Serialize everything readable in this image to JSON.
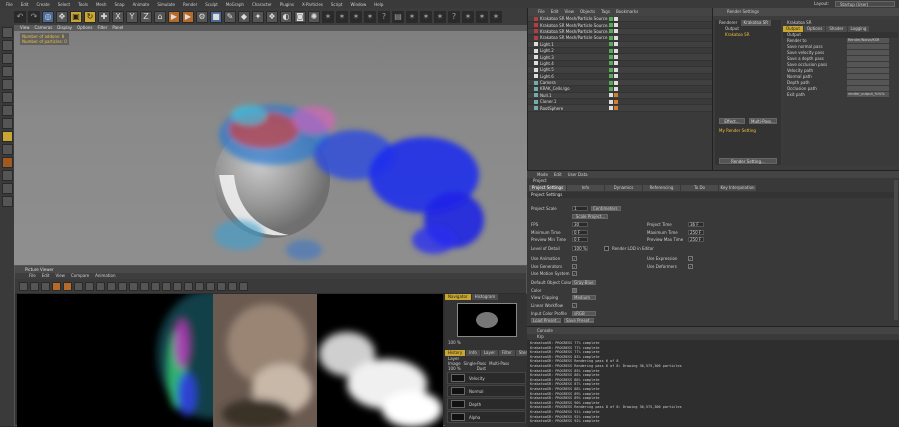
{
  "menubar": {
    "items": [
      "File",
      "Edit",
      "Create",
      "Select",
      "Tools",
      "Mesh",
      "Snap",
      "Animate",
      "Simulate",
      "Render",
      "Sculpt",
      "MoGraph",
      "Character",
      "Plugins",
      "X-Particles",
      "Script",
      "Window",
      "Help"
    ],
    "layout_label": "Layout:",
    "layout_value": "Startup (User)"
  },
  "viewport": {
    "menu": [
      "View",
      "Cameras",
      "Display",
      "Options",
      "Filter",
      "Panel"
    ],
    "info_lines": [
      "Number of addons: 8",
      "Number of particles: 0"
    ]
  },
  "picture_viewer": {
    "title": "Picture Viewer",
    "menu": [
      "File",
      "Edit",
      "View",
      "Compare",
      "Animation"
    ],
    "right_tabs": [
      "Navigator",
      "Histogram"
    ],
    "zoom": "100 %",
    "lower_tabs": [
      "History",
      "Info",
      "Layer",
      "Filter",
      "Stereo"
    ],
    "layer_label": "Layer",
    "layer_modes": [
      "Image",
      "Single-Pass",
      "Multi-Pass"
    ],
    "layer_zoom": "100 %",
    "layer_blend": "Dust",
    "layers": [
      "Velocity",
      "Normal",
      "Depth",
      "Alpha"
    ]
  },
  "object_manager": {
    "menu": [
      "File",
      "Edit",
      "View",
      "Objects",
      "Tags",
      "Bookmarks"
    ],
    "rows": [
      "Krakatoa SR Mesh/Particle Source",
      "Krakatoa SR Mesh/Particle Source.1",
      "Krakatoa SR Mesh/Particle Source.2",
      "Krakatoa SR Mesh/Particle Source",
      "Light.1",
      "Light.2",
      "Light.3",
      "Light.4",
      "Light.5",
      "Light.6",
      "Camera",
      "KRAK_Cells.lgo",
      "Null.1",
      "Cloner.1",
      "RootSphere"
    ]
  },
  "render_settings": {
    "title": "Render Settings",
    "renderer_label": "Renderer",
    "renderer_value": "Krakatoa SR",
    "left_items": [
      "Output",
      "Krakatoa SR"
    ],
    "effect_button": "Effect...",
    "multipass_button": "Multi-Pass...",
    "my_setting": "My Render Setting",
    "render_setting_button": "Render Setting...",
    "header": "Krakatoa SR",
    "tabs": [
      "Output",
      "Options",
      "Shader",
      "Logging"
    ],
    "section": "Output",
    "fields": [
      {
        "label": "Render to",
        "value": "Render/Noise/KSR"
      },
      {
        "label": "Save normal pass",
        "value": ""
      },
      {
        "label": "Save velocity pass",
        "value": ""
      },
      {
        "label": "Save a depth pass",
        "value": ""
      },
      {
        "label": "Save occlusion pass",
        "value": ""
      },
      {
        "label": "Velocity path",
        "value": ""
      },
      {
        "label": "Normal path",
        "value": ""
      },
      {
        "label": "Depth path",
        "value": ""
      },
      {
        "label": "Occlusion path",
        "value": ""
      },
      {
        "label": "Exit path",
        "value": "render_output_%%%"
      }
    ]
  },
  "attributes": {
    "menu": [
      "Mode",
      "Edit",
      "User Data"
    ],
    "object": "Project",
    "tabs": [
      "Project Settings",
      "Info",
      "Dynamics",
      "Referencing",
      "To Do",
      "Key Interpolation"
    ],
    "section": "Project Settings",
    "project_scale_label": "Project Scale",
    "project_scale_value": "1",
    "project_scale_unit": "Centimeters",
    "scale_button": "Scale Project...",
    "left_props": [
      {
        "label": "FPS",
        "value": "30"
      },
      {
        "label": "Minimum Time",
        "value": "0 F"
      },
      {
        "label": "Preview Min Time",
        "value": "0 F"
      }
    ],
    "right_props": [
      {
        "label": "Project Time",
        "value": "36 F"
      },
      {
        "label": "Maximum Time",
        "value": "250 F"
      },
      {
        "label": "Preview Max Time",
        "value": "250 F"
      }
    ],
    "lod_label": "Level of Detail",
    "lod_value": "100 %",
    "render_lod_label": "Render LOD in Editor",
    "checks_left": [
      "Use Animation",
      "Use Generators",
      "Use Motion System"
    ],
    "checks_right": [
      "Use Expression",
      "Use Deformers"
    ],
    "default_color_label": "Default Object Color",
    "default_color_value": "Gray-Blue",
    "color_label": "Color",
    "view_clipping_label": "View Clipping",
    "view_clipping_value": "Medium",
    "linear_workflow_label": "Linear Workflow",
    "input_color_label": "Input Color Profile",
    "input_color_value": "sRGB",
    "load_preset": "Load Preset...",
    "save_preset": "Save Preset..."
  },
  "console": {
    "title": "Console",
    "sub": "Krp",
    "lines": [
      "KrakatoaSR: PROGRESS 77% complete",
      "KrakatoaSR: PROGRESS 77% complete",
      "KrakatoaSR: PROGRESS 77% complete",
      "KrakatoaSR: PROGRESS 83% complete",
      "KrakatoaSR: PROGRESS Rendering pass 6 of 8",
      "KrakatoaSR: PROGRESS Rendering pass 6 of 8: Drawing 36,575,306 particles",
      "KrakatoaSR: PROGRESS 85% complete",
      "KrakatoaSR: PROGRESS 86% complete",
      "KrakatoaSR: PROGRESS 86% complete",
      "KrakatoaSR: PROGRESS 87% complete",
      "KrakatoaSR: PROGRESS 88% complete",
      "KrakatoaSR: PROGRESS 89% complete",
      "KrakatoaSR: PROGRESS 89% complete",
      "KrakatoaSR: PROGRESS 90% complete",
      "KrakatoaSR: PROGRESS Rendering pass 8 of 8: Drawing 36,575,306 particles",
      "KrakatoaSR: PROGRESS 91% complete",
      "KrakatoaSR: PROGRESS 92% complete",
      "KrakatoaSR: PROGRESS 92% complete"
    ]
  },
  "colors": {
    "accent": "#c9a531",
    "panel": "#3a3a3a",
    "dark": "#2b2b2b"
  }
}
